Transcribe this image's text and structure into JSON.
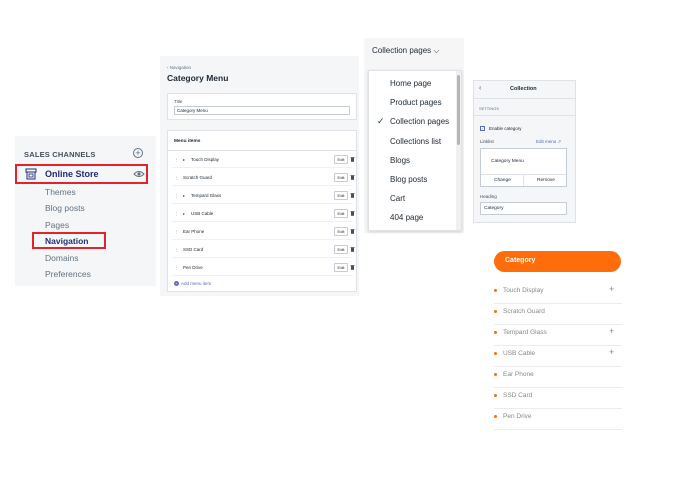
{
  "sales": {
    "header": "SALES CHANNELS",
    "store_label": "Online Store",
    "items": [
      "Themes",
      "Blog posts",
      "Pages",
      "Navigation",
      "Domains",
      "Preferences"
    ],
    "colors": {
      "highlight": "#e3222c",
      "link": "#202e78"
    }
  },
  "menu": {
    "breadcrumb": "‹ Navigation",
    "title": "Category Menu",
    "title_label": "Title",
    "title_value": "Category Menu",
    "items_header": "Menu items",
    "edit_label": "Edit",
    "rows": [
      {
        "name": "Touch Display",
        "expandable": true
      },
      {
        "name": "Scratch Guard",
        "expandable": false
      },
      {
        "name": "Tempard Glass",
        "expandable": true
      },
      {
        "name": "USB Cable",
        "expandable": true
      },
      {
        "name": "Ear Phone",
        "expandable": false
      },
      {
        "name": "SSD Card",
        "expandable": false
      },
      {
        "name": "Pen Drive",
        "expandable": false
      }
    ],
    "add_item": "Add menu item"
  },
  "collection_pages": {
    "selected": "Collection pages",
    "options": [
      "Home page",
      "Product pages",
      "Collection pages",
      "Collections list",
      "Blogs",
      "Blog posts",
      "Cart",
      "404 page"
    ],
    "checked_index": 2
  },
  "collection": {
    "title": "Collection",
    "settings_label": "SETTINGS",
    "enable_label": "Enable category",
    "enabled": true,
    "linklist_label": "Linklist",
    "edit_menu": "Edit menu",
    "linklist_value": "Category Menu",
    "change_label": "Change",
    "remove_label": "Remove",
    "heading_label": "Heading",
    "heading_value": "Category"
  },
  "front": {
    "header": "Category",
    "accent": "#ff6d0a",
    "items": [
      {
        "name": "Touch Display",
        "plus": true
      },
      {
        "name": "Scratch Guard",
        "plus": false
      },
      {
        "name": "Tempard Glass",
        "plus": true
      },
      {
        "name": "USB Cable",
        "plus": true
      },
      {
        "name": "Ear Phone",
        "plus": false
      },
      {
        "name": "SSD Card",
        "plus": false
      },
      {
        "name": "Pen Drive",
        "plus": false
      }
    ]
  }
}
